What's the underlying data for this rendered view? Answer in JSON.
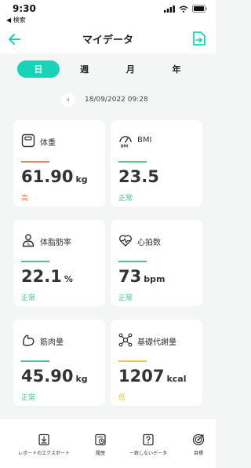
{
  "status_bar": {
    "time": "9:30",
    "back_label": "◀ 検索"
  },
  "header": {
    "title": "マイデータ"
  },
  "tabs": [
    {
      "label": "日",
      "active": true
    },
    {
      "label": "週",
      "active": false
    },
    {
      "label": "月",
      "active": false
    },
    {
      "label": "年",
      "active": false
    }
  ],
  "date": {
    "text": "18/09/2022 09:28"
  },
  "colors": {
    "accent": "#16d4b5",
    "high": "#f07a4a",
    "normal": "#3cc98a",
    "low": "#f2c531"
  },
  "cards": [
    {
      "title": "体重",
      "value": "61.90",
      "unit": "kg",
      "status": "高",
      "status_color": "#f07a4a",
      "icon": "scale-icon"
    },
    {
      "title": "BMI",
      "value": "23.5",
      "unit": "",
      "status": "正常",
      "status_color": "#3cc98a",
      "icon": "bmi-gauge-icon"
    },
    {
      "title": "体脂肪率",
      "value": "22.1",
      "unit": "%",
      "status": "正常",
      "status_color": "#3cc98a",
      "icon": "body-fat-icon"
    },
    {
      "title": "心拍数",
      "value": "73",
      "unit": "bpm",
      "status": "正常",
      "status_color": "#3cc98a",
      "icon": "heart-rate-icon"
    },
    {
      "title": "筋肉量",
      "value": "45.90",
      "unit": "kg",
      "status": "正常",
      "status_color": "#3cc98a",
      "icon": "muscle-icon"
    },
    {
      "title": "基礎代謝量",
      "value": "1207",
      "unit": "kcal",
      "status": "低",
      "status_color": "#f2c531",
      "icon": "metabolism-icon"
    }
  ],
  "bottom_nav": [
    {
      "label": "レポートのエクスポート",
      "icon": "export-report-icon"
    },
    {
      "label": "履歴",
      "icon": "history-icon"
    },
    {
      "label": "一致しないデータ",
      "icon": "unmatched-data-icon"
    },
    {
      "label": "目標",
      "icon": "target-icon"
    }
  ]
}
